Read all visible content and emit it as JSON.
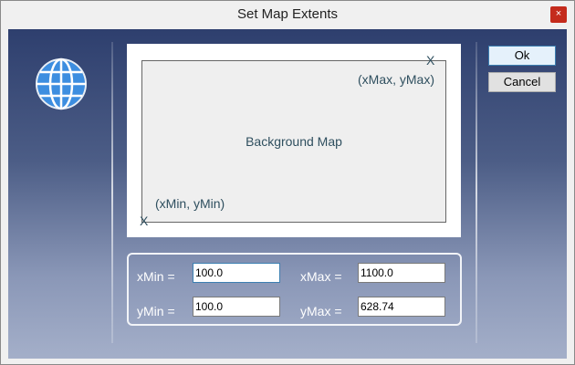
{
  "window": {
    "title": "Set Map Extents",
    "close_glyph": "×"
  },
  "map": {
    "label": "Background Map",
    "max_corner_label": "(xMax, yMax)",
    "min_corner_label": "(xMin, yMin)",
    "corner_marker": "X"
  },
  "fields": {
    "xmin": {
      "label": "xMin =",
      "value": "100.0"
    },
    "xmax": {
      "label": "xMax =",
      "value": "1100.0"
    },
    "ymin": {
      "label": "yMin =",
      "value": "100.0"
    },
    "ymax": {
      "label": "yMax =",
      "value": "628.74"
    }
  },
  "buttons": {
    "ok": "Ok",
    "cancel": "Cancel"
  },
  "icons": {
    "app": "globe-icon",
    "close": "close-icon"
  },
  "colors": {
    "close": "#c42b1c",
    "label_text": "#2f4f5f",
    "focus_border": "#3c7fb1"
  }
}
